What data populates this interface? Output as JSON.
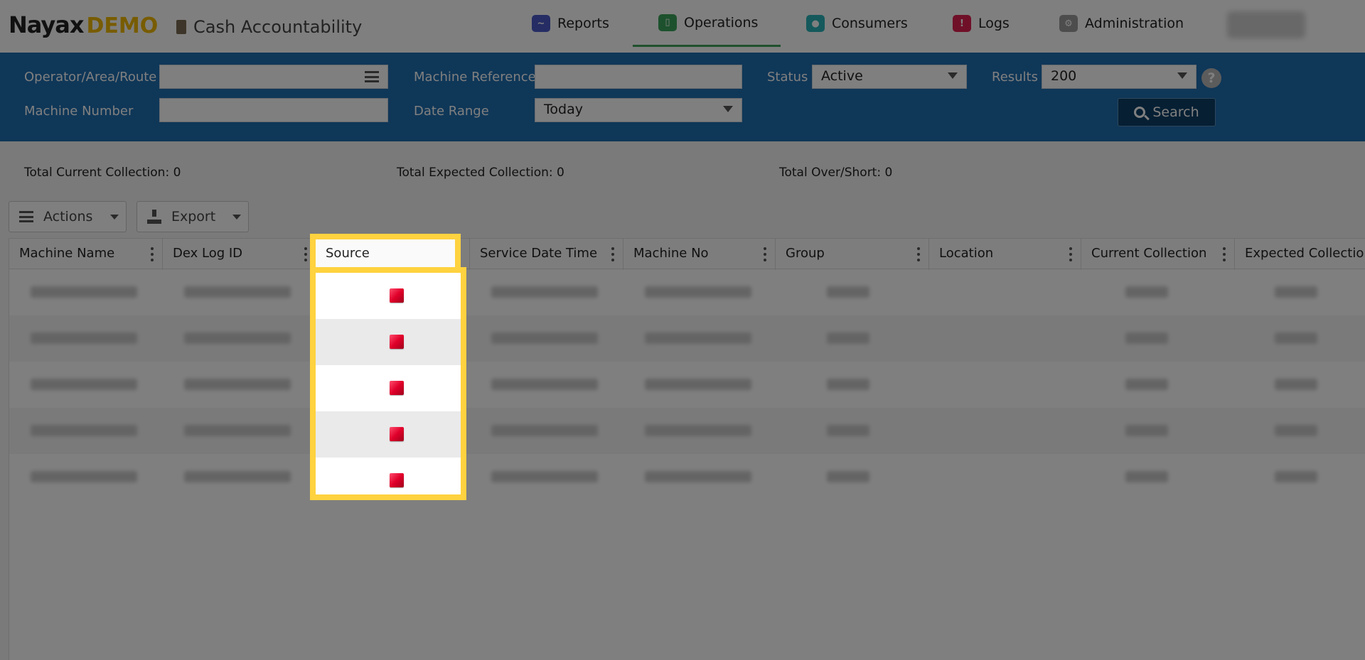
{
  "header": {
    "logo_main": "Nayax",
    "logo_demo": "DEMO",
    "page_title": "Cash Accountability",
    "nav": [
      {
        "label": "Reports",
        "icon": "reports-icon",
        "color": "#4a5ac8"
      },
      {
        "label": "Operations",
        "icon": "operations-icon",
        "color": "#3aa35b"
      },
      {
        "label": "Consumers",
        "icon": "consumers-icon",
        "color": "#2ab3b8"
      },
      {
        "label": "Logs",
        "icon": "logs-icon",
        "color": "#e02050"
      },
      {
        "label": "Administration",
        "icon": "administration-icon",
        "color": "#9a9a9a"
      }
    ],
    "active_nav": "Operations"
  },
  "filters": {
    "operator_label": "Operator/Area/Route",
    "operator_value": "",
    "machine_number_label": "Machine Number",
    "machine_number_value": "",
    "machine_reference_label": "Machine Reference",
    "machine_reference_value": "",
    "date_range_label": "Date Range",
    "date_range_value": "Today",
    "status_label": "Status",
    "status_value": "Active",
    "results_label": "Results",
    "results_value": "200",
    "search_label": "Search",
    "help_label": "?"
  },
  "totals": {
    "current_label": "Total Current Collection:",
    "current_value": "0",
    "expected_label": "Total Expected Collection:",
    "expected_value": "0",
    "overshort_label": "Total Over/Short:",
    "overshort_value": "0"
  },
  "toolbar": {
    "actions_label": "Actions",
    "export_label": "Export"
  },
  "grid": {
    "columns": [
      "Machine Name",
      "Dex Log ID",
      "Source",
      "Service Date Time",
      "Machine No",
      "Group",
      "Location",
      "Current Collection",
      "Expected Collection"
    ],
    "row_count": 5,
    "source_icon": "source-dex-icon"
  },
  "colors": {
    "filter_bar": "#1f6fb0",
    "highlight": "#ffd23f",
    "active_nav_underline": "#41a35b"
  }
}
